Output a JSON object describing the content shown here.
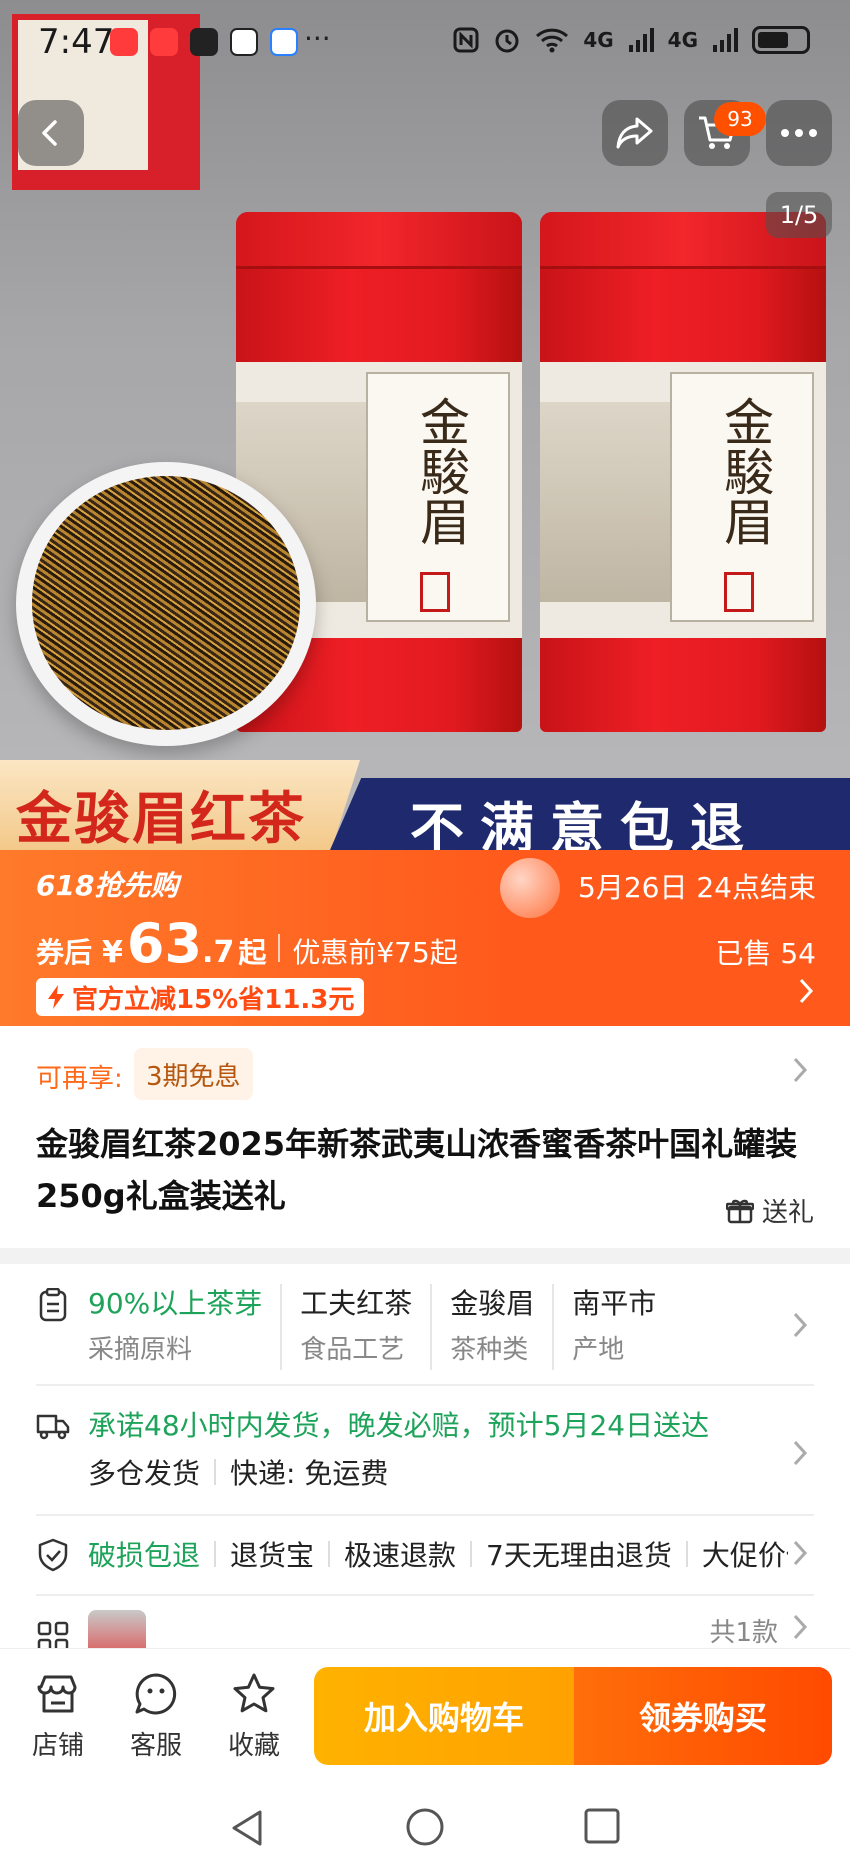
{
  "status_bar": {
    "time": "7:47",
    "more_notifications": "···",
    "network_4g_1": "4G",
    "network_4g_2": "4G"
  },
  "header": {
    "cart_badge": "93",
    "page_indicator": "1/5"
  },
  "hero": {
    "tin_label": "金駿眉",
    "banner_left": "金骏眉红茶",
    "banner_right": "不满意包退"
  },
  "promo": {
    "event": "618抢先购",
    "ends": "5月26日 24点结束",
    "after_coupon_label": "券后",
    "currency": "¥",
    "price_int": "63",
    "price_dec": ".7",
    "price_suffix": "起",
    "before_discount": "优惠前¥75起",
    "sold": "已售 54",
    "official_discount": "官方立减15%省11.3元"
  },
  "title_section": {
    "reenjoy_label": "可再享:",
    "installment_tag": "3期免息",
    "product_title": "金骏眉红茶2025年新茶武夷山浓香蜜香茶叶国礼罐装250g礼盒装送礼",
    "gift_label": "送礼"
  },
  "attributes": [
    {
      "value": "90%以上茶芽",
      "label": "采摘原料"
    },
    {
      "value": "工夫红茶",
      "label": "食品工艺"
    },
    {
      "value": "金骏眉",
      "label": "茶种类"
    },
    {
      "value": "南平市",
      "label": "产地"
    }
  ],
  "shipping": {
    "promise": "承诺48小时内发货，晚发必赔，预计5月24日送达",
    "warehouse": "多仓发货",
    "express": "快递: 免运费"
  },
  "services": [
    "破损包退",
    "退货宝",
    "极速退款",
    "7天无理由退货",
    "大促价保"
  ],
  "sku": {
    "count": "共1款"
  },
  "bottom_bar": {
    "store": "店铺",
    "service": "客服",
    "favorite": "收藏",
    "add_to_cart": "加入购物车",
    "buy_with_coupon": "领券购买"
  },
  "colors": {
    "accent_orange": "#ff5a1c",
    "green": "#1ea35a",
    "cta_yellow": "#ffb200",
    "cta_orange": "#ff4a00"
  }
}
